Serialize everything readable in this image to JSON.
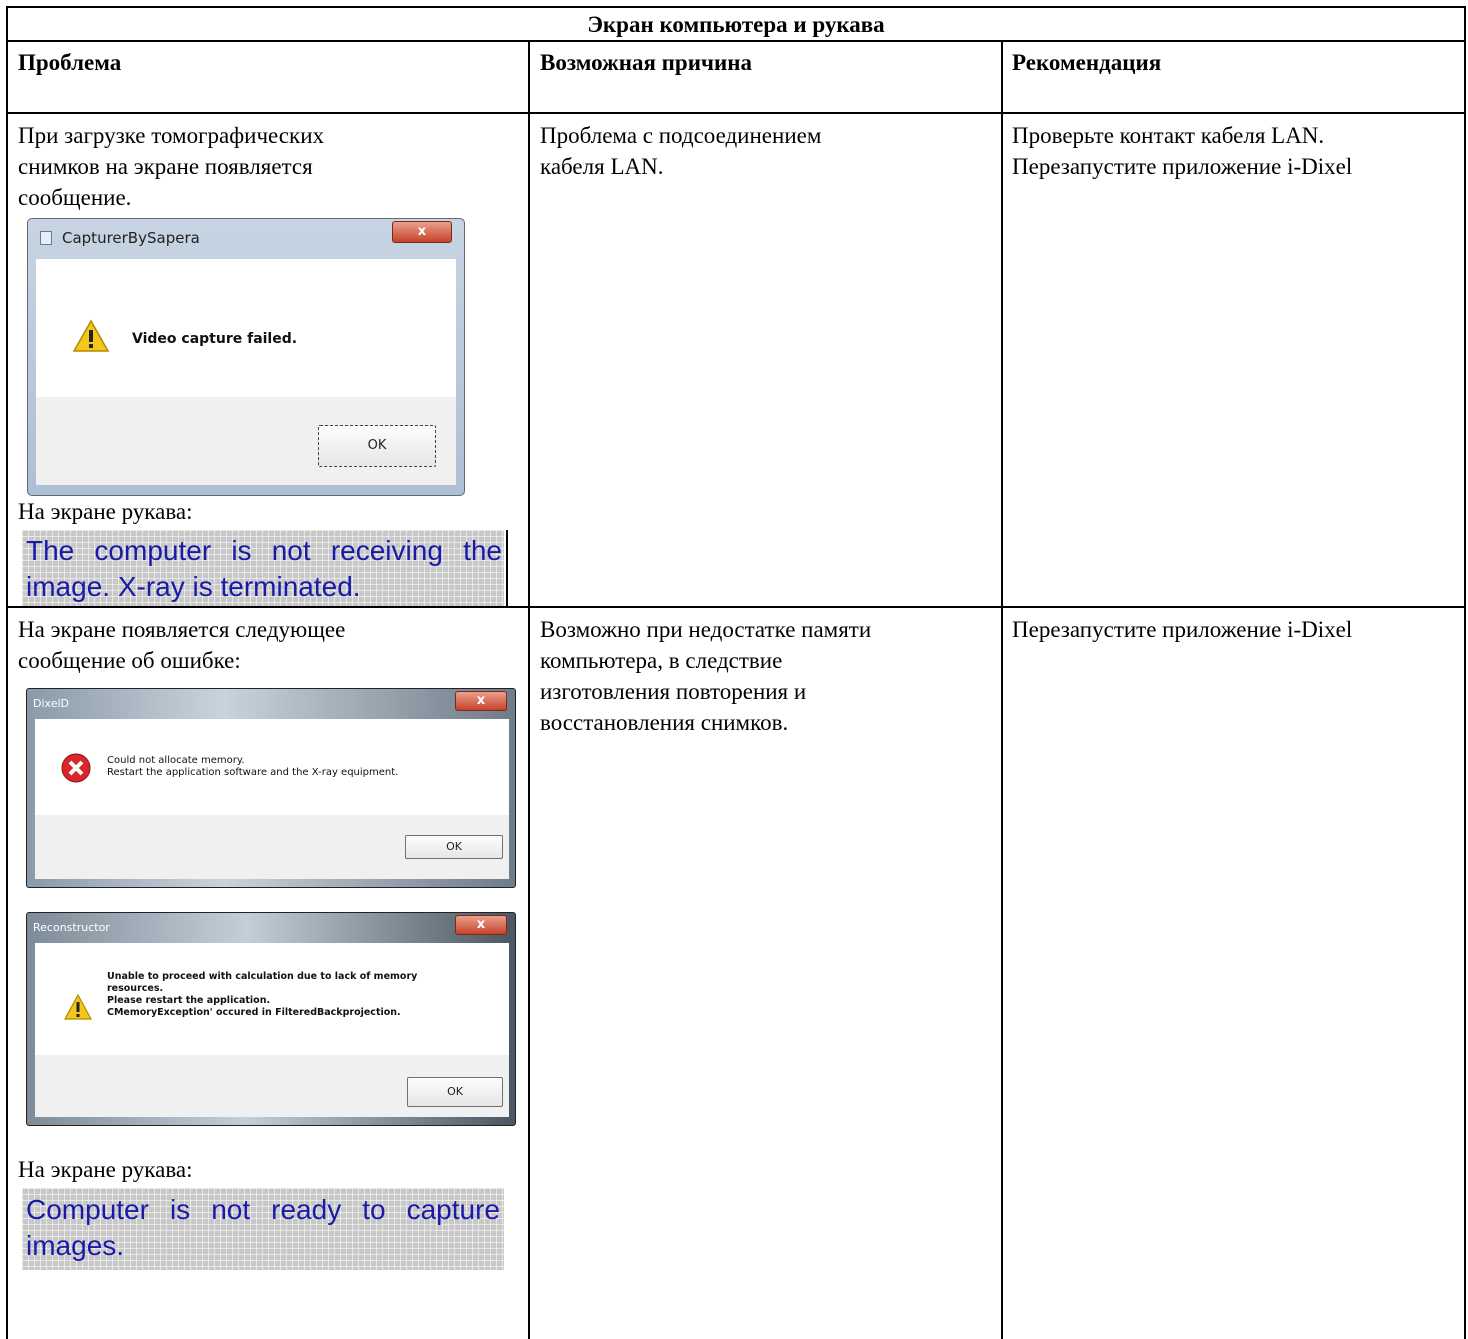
{
  "table": {
    "title": "Экран компьютера и рукава",
    "headers": [
      "Проблема",
      "Возможная причина",
      "Рекомендация"
    ]
  },
  "row1": {
    "problem_lines": [
      "При загрузке томографических",
      "снимков на экране появляется",
      "сообщение."
    ],
    "dialog": {
      "title": "CapturerBySapera",
      "message": "Video capture failed.",
      "ok": "OK",
      "close": "x",
      "icon": "warning-icon"
    },
    "sleeve_caption": "На экране рукава:",
    "sleeve_lines": [
      "The computer is not receiving the",
      "image.   X-ray is terminated."
    ],
    "cause_lines": [
      "Проблема с подсоединением",
      "кабеля LAN."
    ],
    "recommendation_lines": [
      "Проверьте контакт кабеля  LAN.",
      "Перезапустите приложение i-Dixel"
    ]
  },
  "row2": {
    "problem_lines": [
      "На экране появляется следующее",
      "сообщение об ошибке:"
    ],
    "dialog1": {
      "title": "DixelD",
      "message_lines": [
        "Could not allocate memory.",
        "Restart the application software and the X-ray equipment."
      ],
      "ok": "OK",
      "close": "x",
      "icon": "error-icon"
    },
    "dialog2": {
      "title": "Reconstructor",
      "message_lines": [
        "Unable to proceed with calculation due to lack of memory",
        "resources.",
        "Please restart the application.",
        "CMemoryException' occured in FilteredBackprojection."
      ],
      "ok": "OK",
      "close": "x",
      "icon": "warning-icon"
    },
    "sleeve_caption": "На экране рукава:",
    "sleeve_lines": [
      "Computer is not ready to capture",
      "images."
    ],
    "cause_lines": [
      "Возможно при недостатке памяти",
      "компьютера, в следствие",
      "изготовления повторения и",
      "восстановления снимков."
    ],
    "recommendation_lines": [
      "Перезапустите приложение i-Dixel"
    ]
  },
  "colors": {
    "sleeve_text": "#1a1aa8",
    "sleeve_bg": "#c8c8c8"
  }
}
